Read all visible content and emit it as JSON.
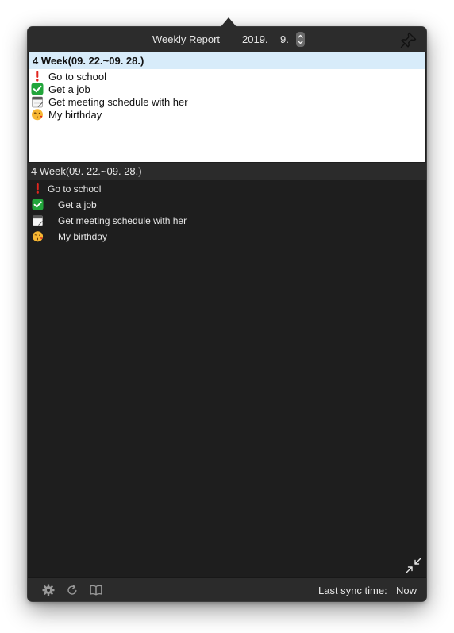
{
  "window": {
    "title": "Weekly Report",
    "year": "2019.",
    "month": "9."
  },
  "icons": {
    "pin": "pin-icon",
    "stepper": "up-down-stepper-icon",
    "important": "exclamation-icon",
    "done": "checkmark-icon",
    "calendar": "calendar-icon",
    "birthday": "kissing-face-icon",
    "collapse": "collapse-arrows-icon",
    "settings": "gear-icon",
    "refresh": "refresh-icon",
    "book": "book-icon"
  },
  "light_list": {
    "header": "4 Week(09. 22.~09. 28.)",
    "items": [
      {
        "label": "Go to school",
        "icon": "exclamation-icon"
      },
      {
        "label": "Get a job",
        "icon": "checkmark-icon"
      },
      {
        "label": "Get meeting schedule with her",
        "icon": "calendar-icon"
      },
      {
        "label": "My birthday",
        "icon": "kissing-face-icon"
      }
    ]
  },
  "dark_list": {
    "header": "4 Week(09. 22.~09. 28.)",
    "items": [
      {
        "label": "Go to school",
        "icon": "exclamation-icon"
      },
      {
        "label": "Get a job",
        "icon": "checkmark-icon"
      },
      {
        "label": "Get meeting schedule with her",
        "icon": "calendar-icon"
      },
      {
        "label": "My birthday",
        "icon": "kissing-face-icon"
      }
    ]
  },
  "footer": {
    "sync_label": "Last sync time:",
    "sync_value": "Now"
  },
  "colors": {
    "popover_bg": "#1e1e1e",
    "titlebar_bg": "#2c2c2c",
    "week_header_highlight": "#d8ecfa",
    "check_green": "#22a53b",
    "exclamation_red": "#e0261f"
  }
}
